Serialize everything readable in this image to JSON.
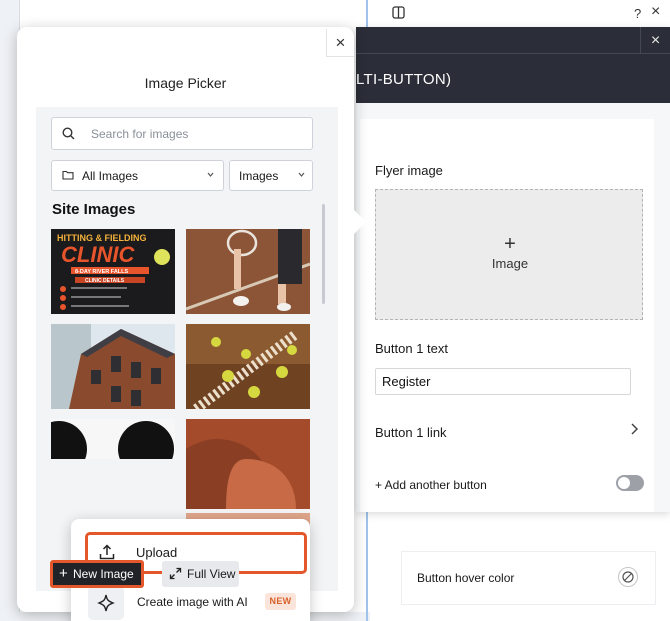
{
  "settings_panel": {
    "title": "LTI-BUTTON)",
    "close_icon": "×",
    "flyer_label": "Flyer image",
    "flyer_plus": "+",
    "flyer_placeholder": "Image",
    "button1_text_label": "Button 1 text",
    "button1_text_value": "Register",
    "button1_link_label": "Button 1 link",
    "add_button_label": "+ Add another button",
    "toggle_on": false,
    "hover_color_label": "Button hover color"
  },
  "top_strip": {
    "help_icon": "?",
    "close_icon": "×"
  },
  "picker": {
    "title": "Image Picker",
    "close_icon": "×",
    "search_placeholder": "Search for images",
    "folder_dropdown": "All Images",
    "type_dropdown": "Images",
    "section_title": "Site Images",
    "thumbnails": [
      {
        "title_line1": "HITTING & FIELDING",
        "title_line2": "CLINIC",
        "subtitle": "8-DAY RIVER FALLS",
        "details": "CLINIC DETAILS"
      }
    ],
    "menu": {
      "upload_label": "Upload",
      "ai_label": "Create image with AI",
      "ai_badge": "NEW"
    },
    "new_image_plus": "+",
    "new_image_label": "New Image",
    "full_view_label": "Full View"
  },
  "colors": {
    "highlight": "#e4572a",
    "header_dark": "#2b2e38",
    "badge_bg": "#fbe4d9",
    "badge_text": "#d9622b"
  }
}
